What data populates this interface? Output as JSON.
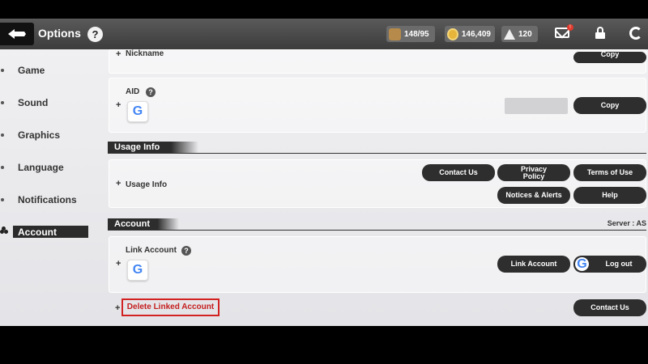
{
  "header": {
    "title": "Options",
    "help_label": "?",
    "resources": {
      "stamina": "148/95",
      "gold": "146,409",
      "gems": "120"
    },
    "mail_badge": "!"
  },
  "sidebar": {
    "items": [
      {
        "label": "Game"
      },
      {
        "label": "Sound"
      },
      {
        "label": "Graphics"
      },
      {
        "label": "Language"
      },
      {
        "label": "Notifications"
      },
      {
        "label": "Account"
      }
    ],
    "active_index": 5
  },
  "profile": {
    "nickname_label": "Nickname",
    "nickname_button": "Copy",
    "aid_label": "AID",
    "aid_help": "?",
    "aid_copy_button": "Copy"
  },
  "usage_info": {
    "section_title": "Usage Info",
    "row_label": "Usage Info",
    "buttons": {
      "contact_us": "Contact Us",
      "privacy_policy_line1": "Privacy",
      "privacy_policy_line2": "Policy",
      "terms_of_use": "Terms of Use",
      "notices_alerts": "Notices & Alerts",
      "help": "Help"
    }
  },
  "account": {
    "section_title": "Account",
    "server_label": "Server : AS",
    "link_account_label": "Link Account",
    "link_help": "?",
    "link_account_button": "Link Account",
    "logout_button": "Log out",
    "delete_linked_account": "Delete Linked Account",
    "contact_us_button": "Contact Us"
  },
  "google_letter": "G",
  "colors": {
    "button_bg": "#2e2e2e",
    "highlight_red": "#d32222",
    "active_nav_bg": "#2b2b2b"
  }
}
